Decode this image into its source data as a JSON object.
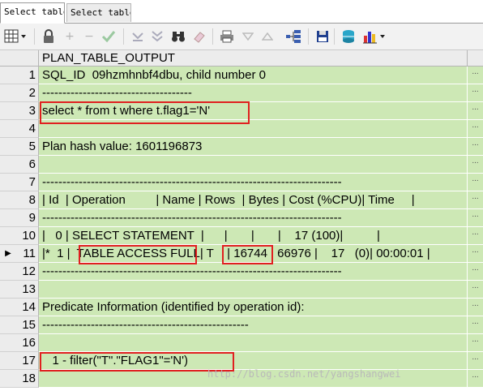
{
  "tabs": [
    {
      "label": "Select table",
      "active": true
    },
    {
      "label": "Select table",
      "active": false
    }
  ],
  "toolbar": {
    "icons": [
      "grid-dropdown-icon",
      "lock-icon",
      "plus-icon",
      "minus-icon",
      "check-icon",
      "arrow-down-icon",
      "arrow-down-double-icon",
      "binoculars-icon",
      "eraser-icon",
      "print-icon",
      "triangle-down-icon",
      "triangle-up-icon",
      "tree-icon",
      "save-icon",
      "database-icon",
      "chart-dropdown-icon"
    ]
  },
  "grid": {
    "column_header": "PLAN_TABLE_OUTPUT",
    "current_row_marker": "▶",
    "cell_ellipsis": "...",
    "rows": [
      {
        "num": "1",
        "text": "SQL_ID  09hzmhnbf4dbu, child number 0"
      },
      {
        "num": "2",
        "text": "-------------------------------------"
      },
      {
        "num": "3",
        "text": "select * from t where t.flag1='N'"
      },
      {
        "num": "4",
        "text": ""
      },
      {
        "num": "5",
        "text": "Plan hash value: 1601196873"
      },
      {
        "num": "6",
        "text": ""
      },
      {
        "num": "7",
        "text": "--------------------------------------------------------------------------"
      },
      {
        "num": "8",
        "text": "| Id  | Operation         | Name | Rows  | Bytes | Cost (%CPU)| Time     |"
      },
      {
        "num": "9",
        "text": "--------------------------------------------------------------------------"
      },
      {
        "num": "10",
        "text": "|   0 | SELECT STATEMENT  |      |       |       |    17 (100)|          |"
      },
      {
        "num": "11",
        "text": "|*  1 |  TABLE ACCESS FULL| T    | 16744 | 66976 |    17   (0)| 00:00:01 |"
      },
      {
        "num": "12",
        "text": "--------------------------------------------------------------------------"
      },
      {
        "num": "13",
        "text": ""
      },
      {
        "num": "14",
        "text": "Predicate Information (identified by operation id):"
      },
      {
        "num": "15",
        "text": "---------------------------------------------------"
      },
      {
        "num": "16",
        "text": ""
      },
      {
        "num": "17",
        "text": "   1 - filter(\"T\".\"FLAG1\"='N')"
      },
      {
        "num": "18",
        "text": ""
      }
    ]
  },
  "watermark": "http://blog.csdn.net/yangshangwei"
}
